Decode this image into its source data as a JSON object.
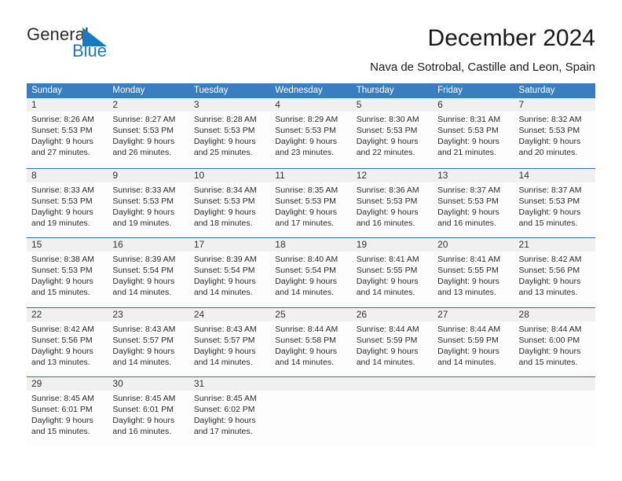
{
  "brand": {
    "name_top": "General",
    "name_bottom": "Blue",
    "color_top": "#2b2b2b",
    "color_bottom": "#1b79c4",
    "triangle_color": "#1b79c4"
  },
  "header": {
    "title": "December 2024",
    "subtitle": "Nava de Sotrobal, Castille and Leon, Spain"
  },
  "theme": {
    "header_blue": "#3b7ebf",
    "row_divider_blue": "#2f6fae",
    "day_band_gray": "#f0f0f0",
    "text_color": "#1a1a1a"
  },
  "calendar": {
    "weekdays": [
      "Sunday",
      "Monday",
      "Tuesday",
      "Wednesday",
      "Thursday",
      "Friday",
      "Saturday"
    ],
    "weeks": [
      [
        {
          "day": "1",
          "lines": [
            "Sunrise: 8:26 AM",
            "Sunset: 5:53 PM",
            "Daylight: 9 hours",
            "and 27 minutes."
          ]
        },
        {
          "day": "2",
          "lines": [
            "Sunrise: 8:27 AM",
            "Sunset: 5:53 PM",
            "Daylight: 9 hours",
            "and 26 minutes."
          ]
        },
        {
          "day": "3",
          "lines": [
            "Sunrise: 8:28 AM",
            "Sunset: 5:53 PM",
            "Daylight: 9 hours",
            "and 25 minutes."
          ]
        },
        {
          "day": "4",
          "lines": [
            "Sunrise: 8:29 AM",
            "Sunset: 5:53 PM",
            "Daylight: 9 hours",
            "and 23 minutes."
          ]
        },
        {
          "day": "5",
          "lines": [
            "Sunrise: 8:30 AM",
            "Sunset: 5:53 PM",
            "Daylight: 9 hours",
            "and 22 minutes."
          ]
        },
        {
          "day": "6",
          "lines": [
            "Sunrise: 8:31 AM",
            "Sunset: 5:53 PM",
            "Daylight: 9 hours",
            "and 21 minutes."
          ]
        },
        {
          "day": "7",
          "lines": [
            "Sunrise: 8:32 AM",
            "Sunset: 5:53 PM",
            "Daylight: 9 hours",
            "and 20 minutes."
          ]
        }
      ],
      [
        {
          "day": "8",
          "lines": [
            "Sunrise: 8:33 AM",
            "Sunset: 5:53 PM",
            "Daylight: 9 hours",
            "and 19 minutes."
          ]
        },
        {
          "day": "9",
          "lines": [
            "Sunrise: 8:33 AM",
            "Sunset: 5:53 PM",
            "Daylight: 9 hours",
            "and 19 minutes."
          ]
        },
        {
          "day": "10",
          "lines": [
            "Sunrise: 8:34 AM",
            "Sunset: 5:53 PM",
            "Daylight: 9 hours",
            "and 18 minutes."
          ]
        },
        {
          "day": "11",
          "lines": [
            "Sunrise: 8:35 AM",
            "Sunset: 5:53 PM",
            "Daylight: 9 hours",
            "and 17 minutes."
          ]
        },
        {
          "day": "12",
          "lines": [
            "Sunrise: 8:36 AM",
            "Sunset: 5:53 PM",
            "Daylight: 9 hours",
            "and 16 minutes."
          ]
        },
        {
          "day": "13",
          "lines": [
            "Sunrise: 8:37 AM",
            "Sunset: 5:53 PM",
            "Daylight: 9 hours",
            "and 16 minutes."
          ]
        },
        {
          "day": "14",
          "lines": [
            "Sunrise: 8:37 AM",
            "Sunset: 5:53 PM",
            "Daylight: 9 hours",
            "and 15 minutes."
          ]
        }
      ],
      [
        {
          "day": "15",
          "lines": [
            "Sunrise: 8:38 AM",
            "Sunset: 5:53 PM",
            "Daylight: 9 hours",
            "and 15 minutes."
          ]
        },
        {
          "day": "16",
          "lines": [
            "Sunrise: 8:39 AM",
            "Sunset: 5:54 PM",
            "Daylight: 9 hours",
            "and 14 minutes."
          ]
        },
        {
          "day": "17",
          "lines": [
            "Sunrise: 8:39 AM",
            "Sunset: 5:54 PM",
            "Daylight: 9 hours",
            "and 14 minutes."
          ]
        },
        {
          "day": "18",
          "lines": [
            "Sunrise: 8:40 AM",
            "Sunset: 5:54 PM",
            "Daylight: 9 hours",
            "and 14 minutes."
          ]
        },
        {
          "day": "19",
          "lines": [
            "Sunrise: 8:41 AM",
            "Sunset: 5:55 PM",
            "Daylight: 9 hours",
            "and 14 minutes."
          ]
        },
        {
          "day": "20",
          "lines": [
            "Sunrise: 8:41 AM",
            "Sunset: 5:55 PM",
            "Daylight: 9 hours",
            "and 13 minutes."
          ]
        },
        {
          "day": "21",
          "lines": [
            "Sunrise: 8:42 AM",
            "Sunset: 5:56 PM",
            "Daylight: 9 hours",
            "and 13 minutes."
          ]
        }
      ],
      [
        {
          "day": "22",
          "lines": [
            "Sunrise: 8:42 AM",
            "Sunset: 5:56 PM",
            "Daylight: 9 hours",
            "and 13 minutes."
          ]
        },
        {
          "day": "23",
          "lines": [
            "Sunrise: 8:43 AM",
            "Sunset: 5:57 PM",
            "Daylight: 9 hours",
            "and 14 minutes."
          ]
        },
        {
          "day": "24",
          "lines": [
            "Sunrise: 8:43 AM",
            "Sunset: 5:57 PM",
            "Daylight: 9 hours",
            "and 14 minutes."
          ]
        },
        {
          "day": "25",
          "lines": [
            "Sunrise: 8:44 AM",
            "Sunset: 5:58 PM",
            "Daylight: 9 hours",
            "and 14 minutes."
          ]
        },
        {
          "day": "26",
          "lines": [
            "Sunrise: 8:44 AM",
            "Sunset: 5:59 PM",
            "Daylight: 9 hours",
            "and 14 minutes."
          ]
        },
        {
          "day": "27",
          "lines": [
            "Sunrise: 8:44 AM",
            "Sunset: 5:59 PM",
            "Daylight: 9 hours",
            "and 14 minutes."
          ]
        },
        {
          "day": "28",
          "lines": [
            "Sunrise: 8:44 AM",
            "Sunset: 6:00 PM",
            "Daylight: 9 hours",
            "and 15 minutes."
          ]
        }
      ],
      [
        {
          "day": "29",
          "lines": [
            "Sunrise: 8:45 AM",
            "Sunset: 6:01 PM",
            "Daylight: 9 hours",
            "and 15 minutes."
          ]
        },
        {
          "day": "30",
          "lines": [
            "Sunrise: 8:45 AM",
            "Sunset: 6:01 PM",
            "Daylight: 9 hours",
            "and 16 minutes."
          ]
        },
        {
          "day": "31",
          "lines": [
            "Sunrise: 8:45 AM",
            "Sunset: 6:02 PM",
            "Daylight: 9 hours",
            "and 17 minutes."
          ]
        },
        {
          "day": "",
          "lines": []
        },
        {
          "day": "",
          "lines": []
        },
        {
          "day": "",
          "lines": []
        },
        {
          "day": "",
          "lines": []
        }
      ]
    ]
  }
}
